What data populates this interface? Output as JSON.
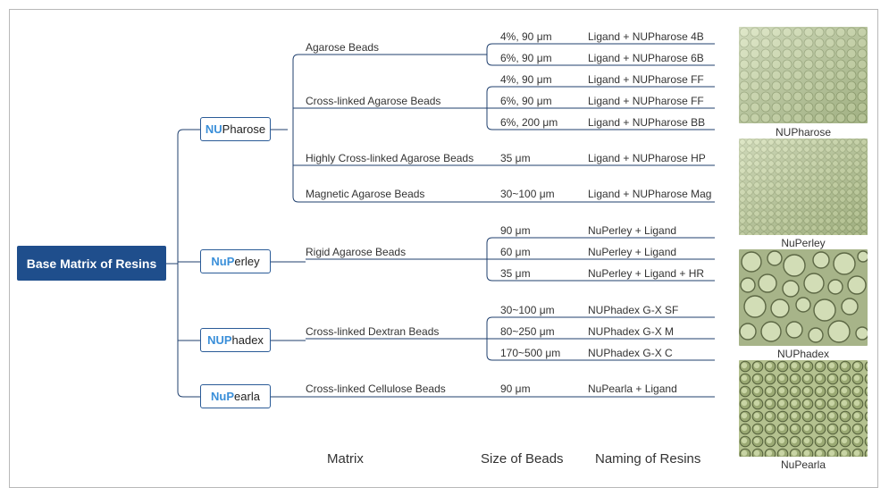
{
  "root": {
    "label": "Base Matrix of Resins"
  },
  "brands": [
    {
      "prefix": "NU",
      "rest": "Pharose"
    },
    {
      "prefix": "NuP",
      "rest": "erley"
    },
    {
      "prefix": "NUP",
      "rest": "hadex"
    },
    {
      "prefix": "NuP",
      "rest": "earla"
    }
  ],
  "matrices": [
    "Agarose Beads",
    "Cross-linked Agarose Beads",
    "Highly Cross-linked Agarose Beads",
    "Magnetic Agarose Beads",
    "Rigid Agarose Beads",
    "Cross-linked Dextran Beads",
    "Cross-linked Cellulose Beads"
  ],
  "rows": [
    {
      "size": "4%, 90 μm",
      "name": "Ligand + NUPharose 4B"
    },
    {
      "size": "6%, 90 μm",
      "name": "Ligand + NUPharose 6B"
    },
    {
      "size": "4%, 90 μm",
      "name": "Ligand + NUPharose FF"
    },
    {
      "size": "6%, 90 μm",
      "name": "Ligand + NUPharose FF"
    },
    {
      "size": "6%, 200 μm",
      "name": "Ligand + NUPharose BB"
    },
    {
      "size": "35 μm",
      "name": "Ligand + NUPharose HP"
    },
    {
      "size": "30~100 μm",
      "name": "Ligand + NUPharose Mag"
    },
    {
      "size": "90 μm",
      "name": "NuPerley + Ligand"
    },
    {
      "size": "60 μm",
      "name": "NuPerley + Ligand"
    },
    {
      "size": "35 μm",
      "name": "NuPerley + Ligand + HR"
    },
    {
      "size": "30~100 μm",
      "name": "NUPhadex G-X SF"
    },
    {
      "size": "80~250 μm",
      "name": "NUPhadex G-X M"
    },
    {
      "size": "170~500 μm",
      "name": "NUPhadex G-X C"
    },
    {
      "size": "90 μm",
      "name": "NuPearla + Ligand"
    }
  ],
  "footer": {
    "matrix": "Matrix",
    "size": "Size of Beads",
    "naming": "Naming of Resins"
  },
  "images": [
    {
      "caption": "NUPharose"
    },
    {
      "caption": "NuPerley"
    },
    {
      "caption": "NUPhadex"
    },
    {
      "caption": "NuPearla"
    }
  ],
  "colors": {
    "root": "#1f4e8c",
    "brand_border": "#2a5b97",
    "brand_prefix": "#3a8fd9",
    "lines": "#1f3f6e"
  }
}
